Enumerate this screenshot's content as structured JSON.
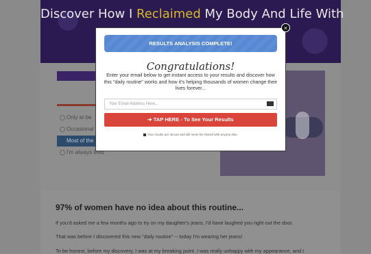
{
  "hero": {
    "title_a": "Discover How I ",
    "title_highlight": "Reclaimed",
    "title_b": " My Body And Life With"
  },
  "quiz": {
    "options": [
      {
        "label": "Only at be",
        "selected": false
      },
      {
        "label": "Occasional",
        "selected": false
      },
      {
        "label": "Most of the",
        "selected": true
      },
      {
        "label": "I'm always tired",
        "selected": false
      }
    ]
  },
  "article": {
    "heading": "97% of women have no idea about this routine...",
    "p1": "If you'd asked me a few months ago to try on my daughter's jeans, I'd have laughed you right out the door.",
    "p2": "That was before I discovered this new \"daily routine\" -- today I'm wearing her jeans!",
    "p3": "To be honest, before my discovery, I was at my breaking point. I was really unhappy with my appearance, and I"
  },
  "modal": {
    "banner": "RESULTS ANALYSIS COMPLETE!",
    "congrats": "Congratulations!",
    "description": "Enter your email below to get instant access to your results and discover how this \"daily routine\" works and how it's helping thousands of women change their lives forever...",
    "email_placeholder": "Your Email Address Here...",
    "cta_label": "TAP HERE - To See Your Results",
    "secure_note": "Your results are secure and will never be shared with anyone else.",
    "close_symbol": "×"
  },
  "colors": {
    "hero_bg": "#2b1a52",
    "highlight": "#d7b92a",
    "banner": "#5f8ed6",
    "cta": "#d9453a"
  },
  "icons": [
    "close-icon",
    "mail-icon",
    "arrow-right-icon",
    "lock-icon"
  ]
}
